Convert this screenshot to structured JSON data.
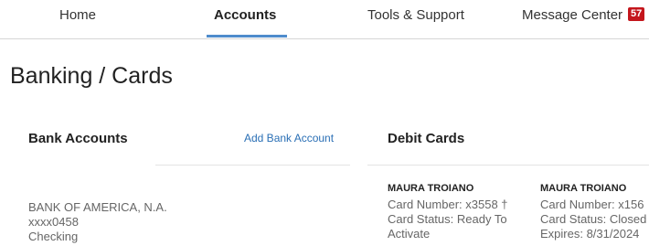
{
  "nav": {
    "home": "Home",
    "accounts": "Accounts",
    "tools": "Tools & Support",
    "messages": "Message Center",
    "messages_badge": "57",
    "active_color": "#4f8ccc",
    "badge_color": "#c4161c"
  },
  "page": {
    "title": "Banking / Cards"
  },
  "bank_accounts": {
    "title": "Bank Accounts",
    "add_link": "Add Bank Account",
    "accounts": [
      {
        "bank": "BANK OF AMERICA, N.A.",
        "number": "xxxx0458",
        "type": "Checking"
      }
    ]
  },
  "debit_cards": {
    "title": "Debit Cards",
    "cards": [
      {
        "holder": "MAURA TROIANO",
        "number": "Card Number: x3558 †",
        "status": "Card Status: Ready To Activate"
      },
      {
        "holder": "MAURA TROIANO",
        "number": "Card Number: x156",
        "status": "Card Status: Closed",
        "expires": "Expires: 8/31/2024"
      }
    ]
  }
}
